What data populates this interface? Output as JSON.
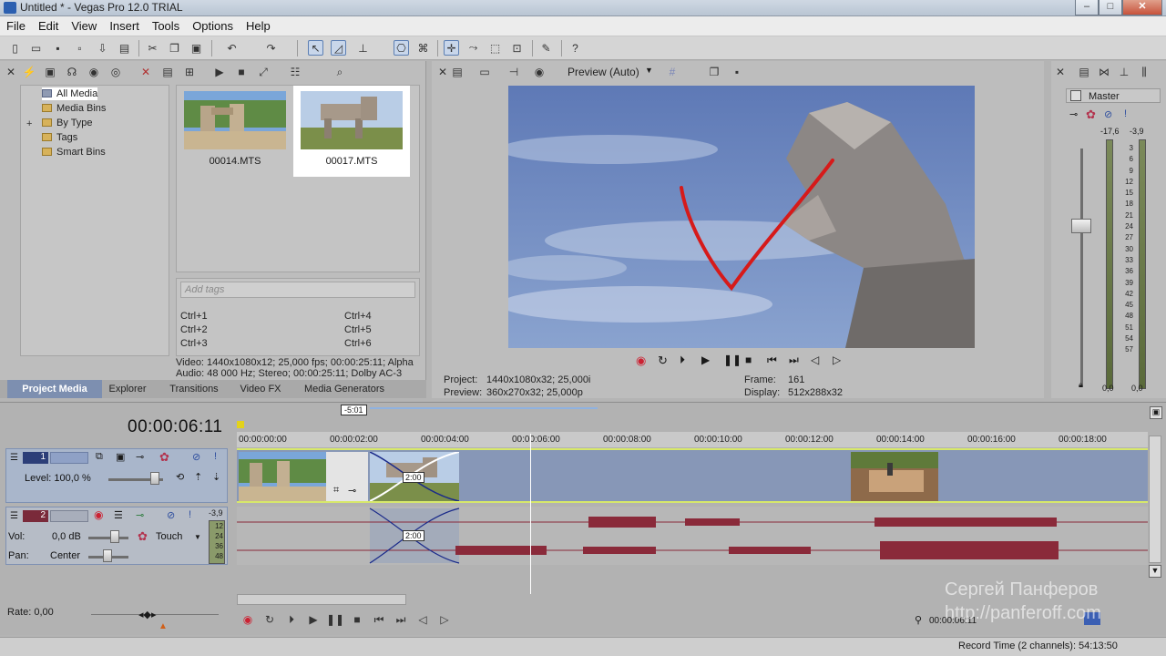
{
  "window": {
    "title": "Untitled * - Vegas Pro 12.0 TRIAL",
    "min": "–",
    "max": "□",
    "close": "✕"
  },
  "menu": [
    "File",
    "Edit",
    "View",
    "Insert",
    "Tools",
    "Options",
    "Help"
  ],
  "media": {
    "tree": [
      {
        "label": "All Media",
        "selected": true
      },
      {
        "label": "Media Bins"
      },
      {
        "label": "By Type",
        "expand": "+"
      },
      {
        "label": "Tags"
      },
      {
        "label": "Smart Bins"
      }
    ],
    "files": [
      {
        "name": "00014.MTS",
        "selected": false
      },
      {
        "name": "00017.MTS",
        "selected": true
      }
    ],
    "tags_placeholder": "Add tags",
    "shortcuts": [
      "Ctrl+1",
      "Ctrl+2",
      "Ctrl+3",
      "Ctrl+4",
      "Ctrl+5",
      "Ctrl+6"
    ],
    "info_video": "Video: 1440x1080x12; 25,000 fps; 00:00:25:11; Alpha",
    "info_audio": "Audio: 48 000 Hz; Stereo; 00:00:25:11; Dolby AC-3"
  },
  "tabs": [
    "Project Media",
    "Explorer",
    "Transitions",
    "Video FX",
    "Media Generators"
  ],
  "preview": {
    "mode": "Preview (Auto)",
    "project_label": "Project:",
    "project_value": "1440x1080x32; 25,000i",
    "preview_label": "Preview:",
    "preview_value": "360x270x32; 25,000p",
    "frame_label": "Frame:",
    "frame_value": "161",
    "display_label": "Display:",
    "display_value": "512x288x32"
  },
  "master": {
    "label": "Master",
    "peak_left": "-17,6",
    "peak_right": "-3,9",
    "scale": [
      "3",
      "6",
      "9",
      "12",
      "15",
      "18",
      "21",
      "24",
      "27",
      "30",
      "33",
      "36",
      "39",
      "42",
      "45",
      "48",
      "51",
      "54",
      "57"
    ],
    "val_left": "0,0",
    "val_right": "0,0"
  },
  "timeline": {
    "timecode": "00:00:06:11",
    "loop_marker": "-5:01",
    "ticks": [
      "00:00:00:00",
      "00:00:02:00",
      "00:00:04:00",
      "00:00:06:00",
      "00:00:08:00",
      "00:00:10:00",
      "00:00:12:00",
      "00:00:14:00",
      "00:00:16:00",
      "00:00:18:00"
    ],
    "video_track": {
      "num": "1",
      "level": "Level: 100,0 %",
      "fade": "2:00"
    },
    "audio_track": {
      "num": "2",
      "vol_label": "Vol:",
      "vol_value": "0,0 dB",
      "pan_label": "Pan:",
      "pan_value": "Center",
      "automation": "Touch",
      "meter_peak": "-3,9",
      "meter_scale": [
        "12",
        "24",
        "36",
        "48"
      ],
      "fade": "2:00"
    },
    "rate": "Rate: 0,00",
    "time_readout": "00:00:06:11"
  },
  "status": {
    "record_time": "Record Time (2 channels): 54:13:50"
  },
  "watermark": {
    "line1": "Сергей Панферов",
    "line2": "http://panferoff.com"
  }
}
